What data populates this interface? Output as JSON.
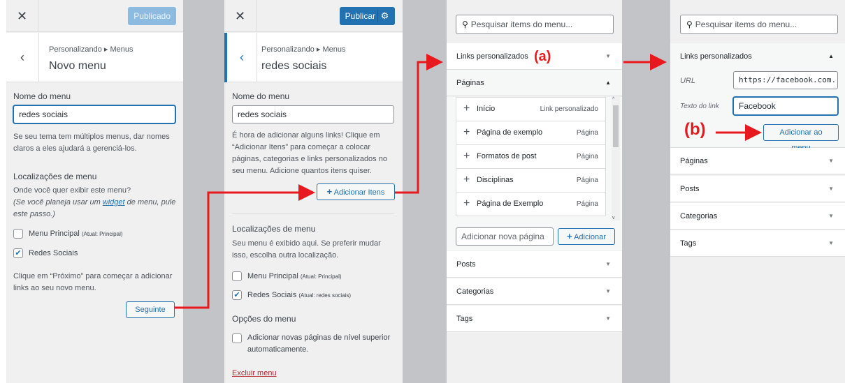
{
  "panel1": {
    "publish_label": "Publicado",
    "breadcrumb": "Personalizando ▸ Menus",
    "title": "Novo menu",
    "name_label": "Nome do menu",
    "name_value": "redes sociais",
    "hint": "Se seu tema tem múltiplos menus, dar nomes claros a eles ajudará a gerenciá-los.",
    "locations_heading": "Localizações de menu",
    "locations_question": "Onde você quer exibir este menu?",
    "locations_note_pre": "(Se você planeja usar um ",
    "locations_note_link": "widget",
    "locations_note_post": " de menu, pule este passo.)",
    "loc1_label": "Menu Principal",
    "loc1_sub": "(Atual: Principal)",
    "loc2_label": "Redes Sociais",
    "next_hint": "Clique em “Próximo” para começar a adicionar links ao seu novo menu.",
    "next_button": "Seguinte"
  },
  "panel2": {
    "publish_label": "Publicar",
    "breadcrumb": "Personalizando ▸ Menus",
    "title": "redes sociais",
    "name_label": "Nome do menu",
    "name_value": "redes sociais",
    "hint": "É hora de adicionar alguns links! Clique em “Adicionar Itens” para começar a colocar páginas, categorias e links personalizados no seu menu. Adicione quantos itens quiser.",
    "add_items_button": "Adicionar Itens",
    "locations_heading": "Localizações de menu",
    "locations_text": "Seu menu é exibido aqui. Se preferir mudar isso, escolha outra localização.",
    "loc1_label": "Menu Principal",
    "loc1_sub": "(Atual: Principal)",
    "loc2_label": "Redes Sociais",
    "loc2_sub": "(Atual: redes sociais)",
    "options_heading": "Opções do menu",
    "auto_add_label": "Adicionar novas páginas de nível superior automaticamente.",
    "delete_link": "Excluir menu"
  },
  "panel3": {
    "search_placeholder": "Pesquisar items do menu...",
    "custom_links": "Links personalizados",
    "annotation": "(a)",
    "pages": "Páginas",
    "items": [
      {
        "title": "Início",
        "type": "Link personalizado"
      },
      {
        "title": "Página de exemplo",
        "type": "Página"
      },
      {
        "title": "Formatos de post",
        "type": "Página"
      },
      {
        "title": "Disciplinas",
        "type": "Página"
      },
      {
        "title": "Página de Exemplo",
        "type": "Página"
      }
    ],
    "new_page_placeholder": "Adicionar nova página",
    "add_button": "Adicionar",
    "posts": "Posts",
    "categories": "Categorias",
    "tags": "Tags"
  },
  "panel4": {
    "search_placeholder": "Pesquisar items do menu...",
    "custom_links": "Links personalizados",
    "url_label": "URL",
    "url_value": "https://facebook.com.",
    "link_text_label": "Texto do link",
    "link_text_value": "Facebook",
    "annotation": "(b)",
    "add_to_menu": "Adicionar ao menu",
    "pages": "Páginas",
    "posts": "Posts",
    "categories": "Categorias",
    "tags": "Tags"
  },
  "colors": {
    "accent": "#2271b1",
    "annotation_red": "#e8191e",
    "panel_bg": "#f0f0f1",
    "gap": "#c3c4c7"
  }
}
